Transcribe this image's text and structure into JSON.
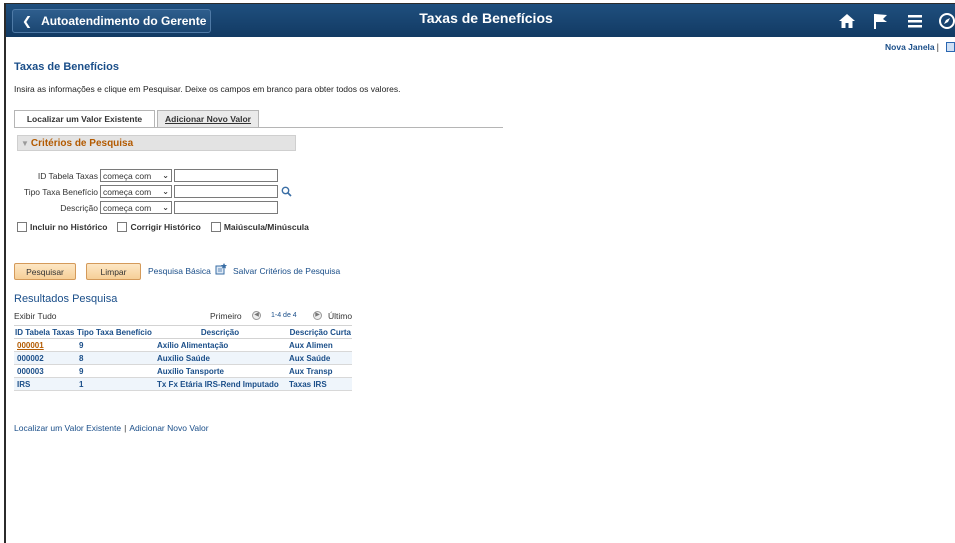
{
  "header": {
    "back_label": "Autoatendimento do Gerente",
    "title": "Taxas de Benefícios",
    "icons": [
      "home-icon",
      "flag-icon",
      "menu-icon",
      "compass-icon"
    ]
  },
  "new_window": {
    "label": "Nova Janela",
    "separator": "|"
  },
  "page": {
    "title": "Taxas de Benefícios",
    "instructions": "Insira as informações e clique em Pesquisar. Deixe os campos em branco para obter todos os valores."
  },
  "tabs": [
    {
      "label": "Localizar um Valor Existente"
    },
    {
      "label": "Adicionar Novo Valor"
    }
  ],
  "criteria": {
    "title": "Critérios de Pesquisa",
    "fields": [
      {
        "label": "ID Tabela Taxas",
        "operator": "começa com",
        "value": ""
      },
      {
        "label": "Tipo Taxa Benefício",
        "operator": "começa com",
        "value": ""
      },
      {
        "label": "Descrição",
        "operator": "começa com",
        "value": ""
      }
    ],
    "checkboxes": [
      {
        "label": "Incluir no Histórico",
        "checked": false
      },
      {
        "label": "Corrigir Histórico",
        "checked": false
      },
      {
        "label": "Maiúscula/Minúscula",
        "checked": false
      }
    ]
  },
  "actions": {
    "search": "Pesquisar",
    "clear": "Limpar",
    "basic_search": "Pesquisa Básica",
    "save_criteria": "Salvar Critérios de Pesquisa"
  },
  "results": {
    "title": "Resultados Pesquisa",
    "show_all": "Exibir Tudo",
    "first": "Primeiro",
    "range": "1-4 de 4",
    "last": "Último",
    "columns": [
      "ID Tabela Taxas",
      "Tipo Taxa Benefício",
      "Descrição",
      "Descrição Curta"
    ],
    "rows": [
      [
        "000001",
        "9",
        "Axílio Alimentação",
        "Aux Alimen"
      ],
      [
        "000002",
        "8",
        "Auxílio Saúde",
        "Aux Saúde"
      ],
      [
        "000003",
        "9",
        "Auxílio Tansporte",
        "Aux Transp"
      ],
      [
        "IRS",
        "1",
        "Tx Fx Etária IRS-Rend Imputado",
        "Taxas IRS"
      ]
    ]
  },
  "footer_links": {
    "find": "Localizar um Valor Existente",
    "separator": "|",
    "add": "Adicionar Novo Valor"
  },
  "colors": {
    "header_bg": "#1a4672",
    "link_blue": "#1a4e89",
    "section_orange": "#b35a00",
    "button_bg": "#f6cf97"
  }
}
